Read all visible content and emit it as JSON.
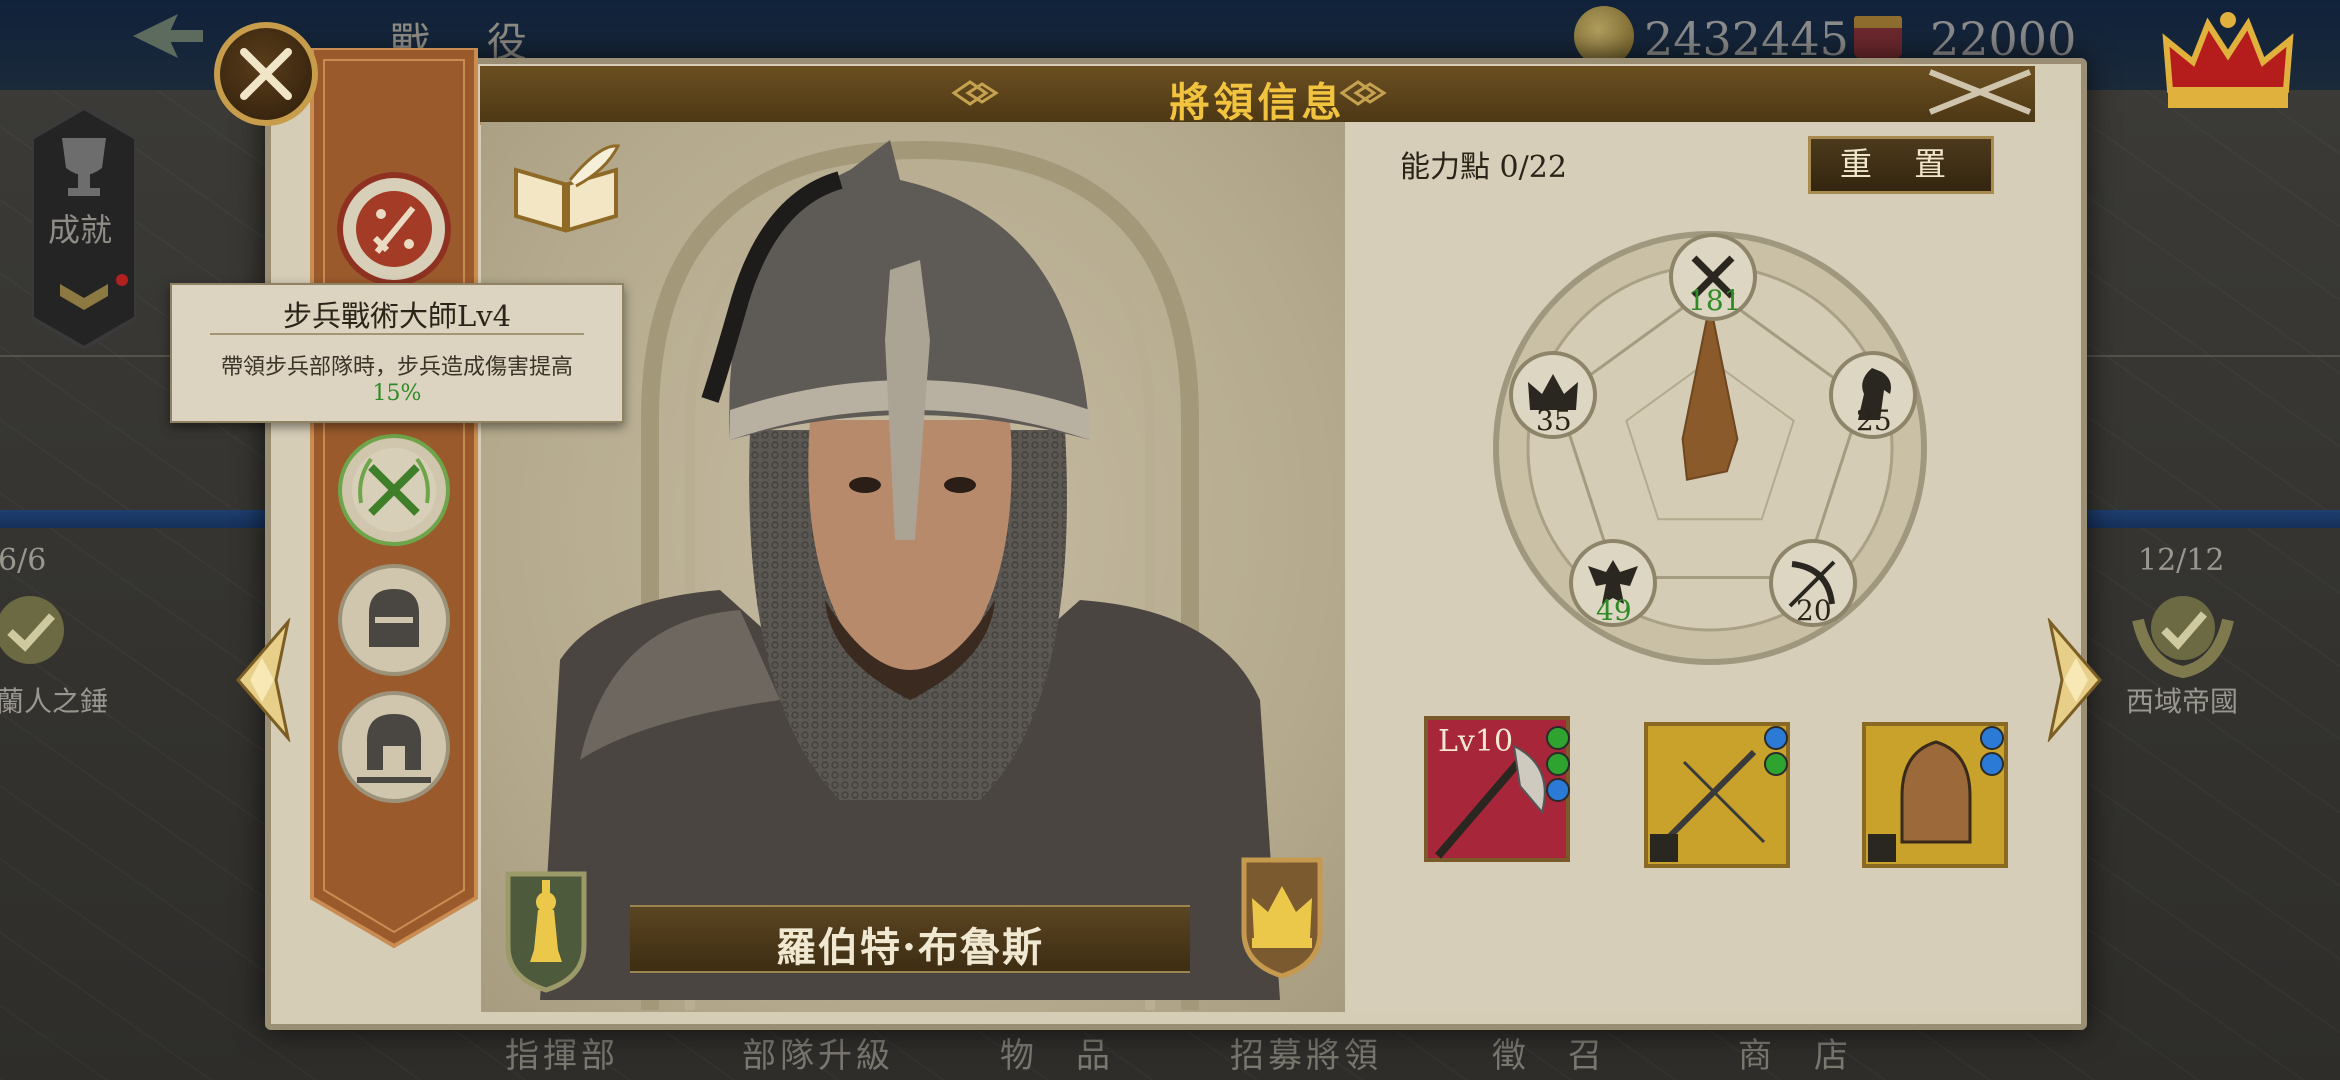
{
  "background": {
    "top_title": "戰 役",
    "gold": "2432445",
    "gems": "22000",
    "achievement_label": "成就",
    "left_stat": "6/6",
    "left_label": "蘭人之錘",
    "right_stat": "12/12",
    "right_label": "西域帝國",
    "bottom_tabs": [
      "指揮部",
      "部隊升級",
      "物　品",
      "招募將領",
      "徵　召",
      "商　店"
    ]
  },
  "dialog": {
    "title": "將領信息",
    "general_name": "羅伯特·布魯斯",
    "ability_points": "能力點 0/22",
    "reset_label": "重 置"
  },
  "tooltip": {
    "title": "步兵戰術大師Lv4",
    "description": "帶領步兵部隊時，步兵造成傷害提高",
    "value": "15%"
  },
  "stats": {
    "infantry": "181",
    "cavalry": "25",
    "archery": "20",
    "defense": "49",
    "command": "35"
  },
  "radar_values": {
    "infantry": 181,
    "cavalry": 25,
    "archery": 20,
    "defense": 49,
    "command": 35,
    "max": 200
  },
  "equipment": {
    "weapon_level": "Lv10"
  },
  "colors": {
    "title_gold": "#f2c33f",
    "stat_green": "#2f8a28",
    "stat_dark": "#2b2418",
    "radar_fill": "#8a5a2a"
  }
}
